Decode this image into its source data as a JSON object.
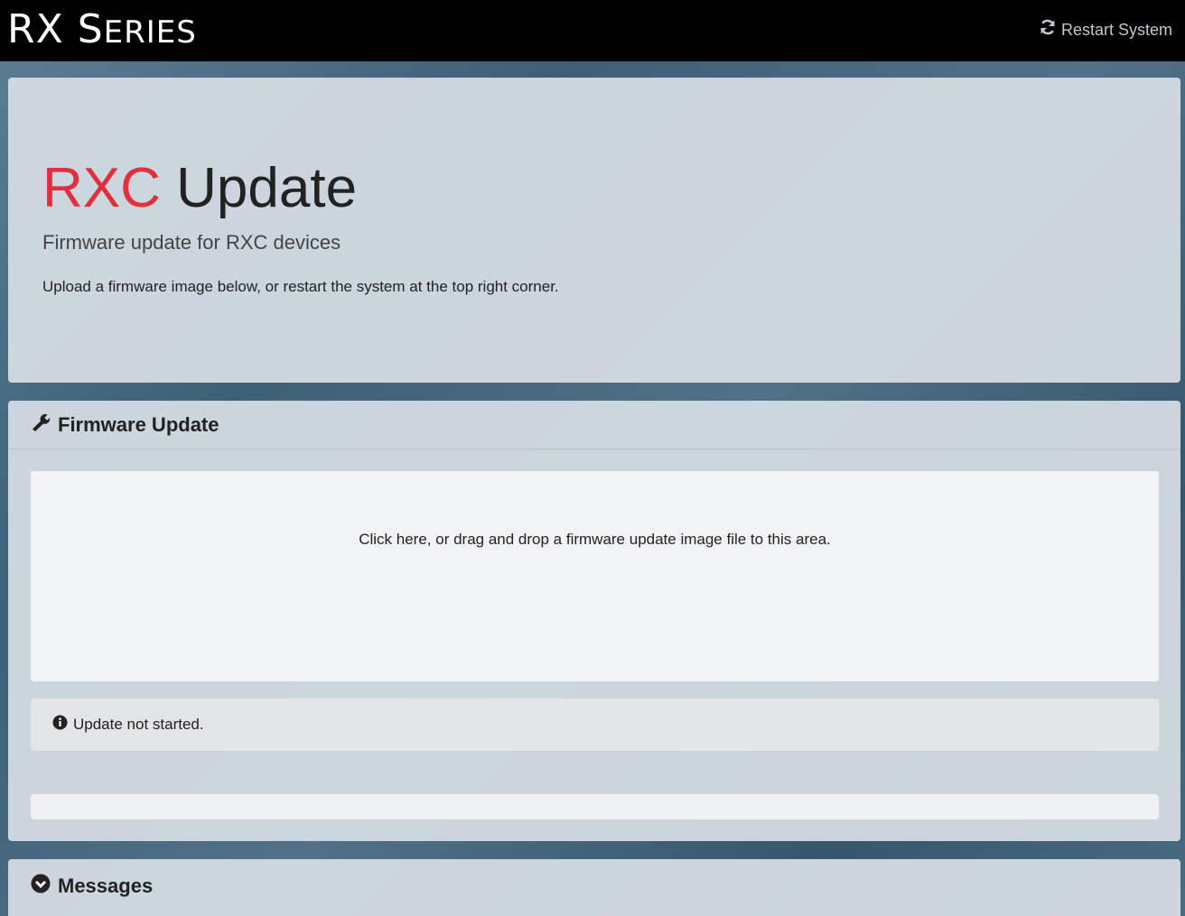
{
  "topbar": {
    "brand_big_1": "R",
    "brand_big_2": "X",
    "brand_big_3": "S",
    "brand_small": "ERIES",
    "restart_label": "Restart System",
    "restart_icon": "refresh-icon"
  },
  "jumbotron": {
    "title_accent": "RXC",
    "title_rest": " Update",
    "subtitle": "Firmware update for RXC devices",
    "description": "Upload a firmware image below, or restart the system at the top right corner.",
    "accent_color": "#e0303d"
  },
  "firmware_panel": {
    "heading": "Firmware Update",
    "heading_icon": "wrench-icon",
    "dropzone_text": "Click here, or drag and drop a firmware update image file to this area.",
    "status_icon": "info-circle-icon",
    "status_text": "Update not started.",
    "progress_percent": 0
  },
  "messages_panel": {
    "heading": "Messages",
    "heading_icon": "chevron-circle-down-icon"
  }
}
